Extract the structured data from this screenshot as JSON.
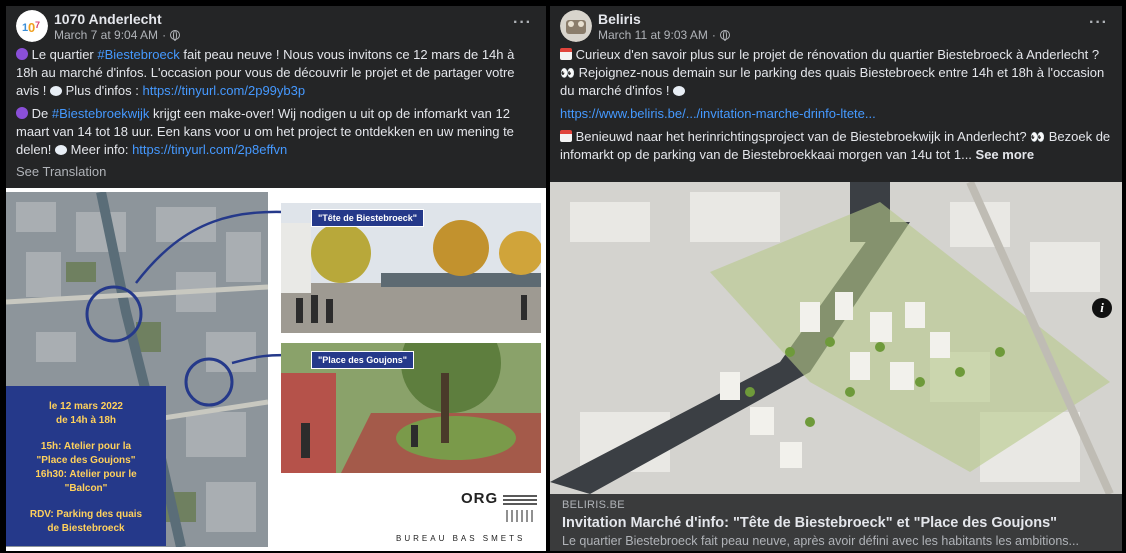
{
  "post1": {
    "author": "1070 Anderlecht",
    "timestamp": "March 7 at 9:04 AM",
    "separator": "·",
    "more_label": "···",
    "para1_a": " Le quartier ",
    "para1_hashtag": "#Biestebroeck",
    "para1_b": " fait peau neuve ! Nous vous invitons ce 12 mars de 14h à 18h au marché d'infos. L'occasion pour vous de découvrir le projet et de partager votre avis ! ",
    "para1_c": " Plus d'infos : ",
    "para1_link": "https://tinyurl.com/2p99yb3p",
    "para2_a": " De ",
    "para2_hashtag": "#Biestebroekwijk",
    "para2_b": " krijgt een make-over! Wij nodigen u uit op de infomarkt van 12 maart van 14 tot 18 uur. Een kans voor u om het project te ontdekken en uw mening te delen! ",
    "para2_c": " Meer info: ",
    "para2_link": "https://tinyurl.com/2p8effvn",
    "see_translation": "See Translation",
    "image": {
      "tag_tete": "\"Tête de Biestebroeck\"",
      "tag_place": "\"Place des Goujons\"",
      "info_lines": [
        "le 12 mars 2022",
        "de 14h à 18h",
        "",
        "15h: Atelier pour la",
        "\"Place des Goujons\"",
        "16h30: Atelier pour le",
        "\"Balcon\"",
        "",
        "RDV: Parking des quais",
        "de Biestebroeck"
      ],
      "org_logo": "ORG",
      "bureau": "BUREAU BAS SMETS"
    }
  },
  "post2": {
    "author": "Beliris",
    "timestamp": "March 11 at 9:03 AM",
    "separator": "·",
    "more_label": "···",
    "para1": " Curieux d'en savoir plus sur le projet de rénovation du quartier Biestebroeck à Anderlecht ? ",
    "para1_eyes": "👀",
    "para1_b": " Rejoignez-nous demain sur le parking des quais Biestebroeck entre 14h et 18h à l'occasion du marché d'infos ! ",
    "link": "https://www.beliris.be/.../invitation-marche-drinfo-ltete...",
    "para2": " Benieuwd naar het herinrichtingsproject van de Biestebroekwijk in Anderlecht? ",
    "para2_eyes": "👀",
    "para2_b": " Bezoek de infomarkt op de parking van de Biestebroekkaai morgen van 14u tot 1... ",
    "see_more": "See more",
    "info_icon": "i",
    "card": {
      "domain": "BELIRIS.BE",
      "title": "Invitation Marché d'info: \"Tête de Biestebroeck\" et \"Place des Goujons\"",
      "description": "Le quartier Biestebroeck fait peau neuve, après avoir défini avec les habitants les ambitions..."
    }
  }
}
